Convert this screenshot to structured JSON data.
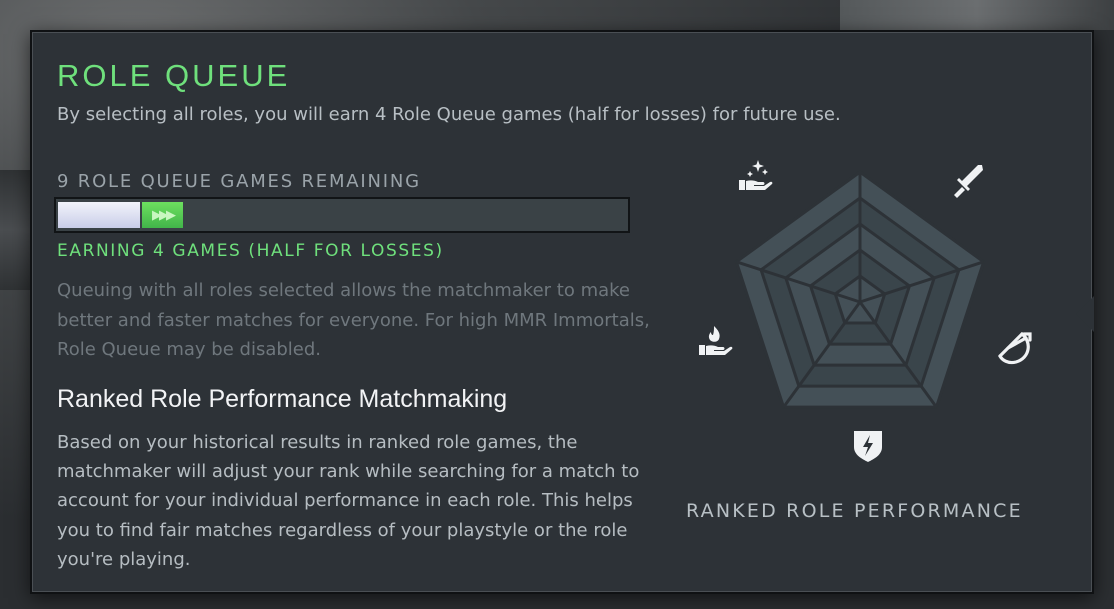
{
  "panel": {
    "title": "ROLE QUEUE",
    "subtitle": "By selecting all roles, you will earn 4 Role Queue games (half for losses) for future use."
  },
  "queue": {
    "games_remaining_label": "9 ROLE QUEUE GAMES REMAINING",
    "current_fraction": 0.145,
    "earning_fraction": 0.072,
    "earning_arrows": "▶▶▶",
    "earning_label": "EARNING 4 GAMES (HALF FOR LOSSES)",
    "description": "Queuing with all roles selected allows the matchmaker to make better and faster matches for everyone. For high MMR Immortals, Role Queue may be disabled."
  },
  "ranked": {
    "heading": "Ranked Role Performance Matchmaking",
    "body": "Based on your historical results in ranked role games, the matchmaker will adjust your rank while searching for a match to account for your individual performance in each role. This helps you to find fair matches regardless of your playstyle or the role you're playing."
  },
  "radar": {
    "label": "RANKED ROLE PERFORMANCE",
    "roles": [
      "hard-support-icon",
      "carry-icon",
      "offlane-icon",
      "mid-icon",
      "soft-support-icon"
    ],
    "colors": {
      "outer": "#445057",
      "inner": "#3a454b",
      "lines": "#2d3237",
      "icon": "#f0f2f4"
    }
  },
  "colors": {
    "accent_green": "#6fe07c",
    "panel_bg": "#2d3237"
  }
}
